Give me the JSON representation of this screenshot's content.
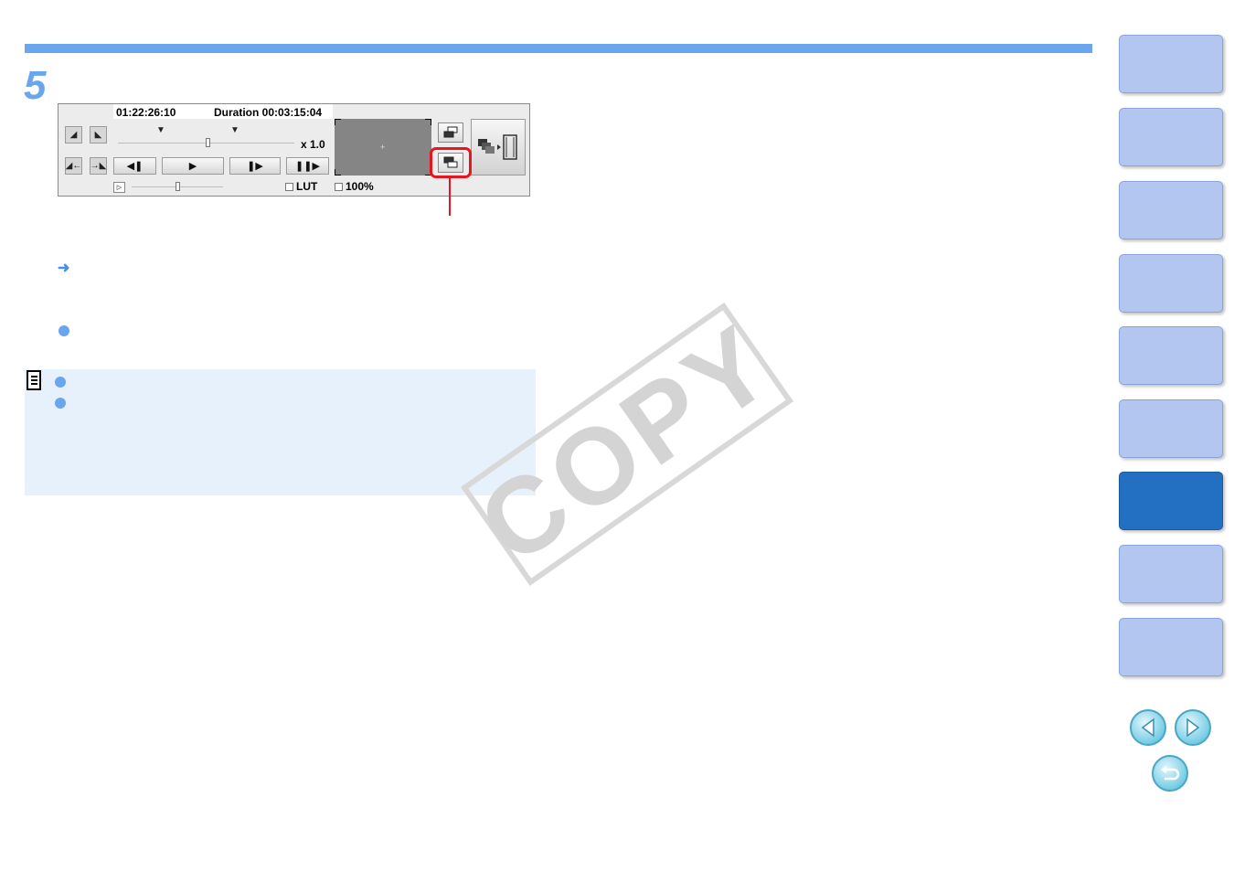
{
  "step": {
    "number": "5"
  },
  "player": {
    "timecode": "01:22:26:10",
    "duration": "Duration 00:03:15:04",
    "speed": "x 1.0",
    "lut_label": "LUT",
    "zoom_label": "100%"
  },
  "watermark": "COPY",
  "colors": {
    "accent": "#6aa6ee",
    "highlight": "#e8141e",
    "tab": "#b3c6ef",
    "tab_active": "#236fc2"
  },
  "sidebar": {
    "tab_count": 9,
    "active_index": 6
  },
  "nav": {
    "prev_icon": "left-arrow-icon",
    "next_icon": "right-arrow-icon",
    "return_icon": "return-icon"
  }
}
